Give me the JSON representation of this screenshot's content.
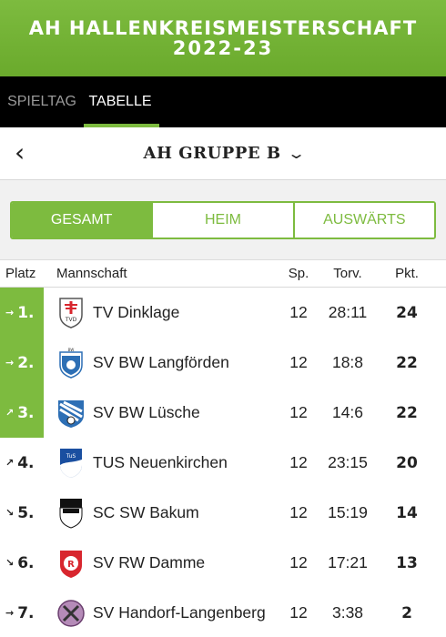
{
  "header": {
    "title": "AH HALLENKREISMEISTERSCHAFT",
    "season": "2022-23"
  },
  "tabs": [
    {
      "label": "SPIELTAG"
    },
    {
      "label": "TABELLE"
    }
  ],
  "group": {
    "back_icon": "chevron-left-icon",
    "title": "AH GRUPPE B",
    "dropdown_icon": "chevron-down-icon"
  },
  "segments": [
    {
      "label": "GESAMT"
    },
    {
      "label": "HEIM"
    },
    {
      "label": "AUSWÄRTS"
    }
  ],
  "columns": {
    "platz": "Platz",
    "team": "Mannschaft",
    "sp": "Sp.",
    "tor": "Torv.",
    "pkt": "Pkt."
  },
  "colors": {
    "accent": "#7dbb3f"
  },
  "rows": [
    {
      "rank": "1.",
      "trend": "→",
      "team": "TV Dinklage",
      "sp": "12",
      "tor": "28:11",
      "pkt": "24",
      "logo": "tv-dinklage-crest"
    },
    {
      "rank": "2.",
      "trend": "→",
      "team": "SV BW Langförden",
      "sp": "12",
      "tor": "18:8",
      "pkt": "22",
      "logo": "sv-bw-langfoerden-crest"
    },
    {
      "rank": "3.",
      "trend": "↗",
      "team": "SV BW Lüsche",
      "sp": "12",
      "tor": "14:6",
      "pkt": "22",
      "logo": "sv-bw-luesche-crest"
    },
    {
      "rank": "4.",
      "trend": "↗",
      "team": "TUS Neuenkirchen",
      "sp": "12",
      "tor": "23:15",
      "pkt": "20",
      "logo": "tus-neuenkirchen-crest"
    },
    {
      "rank": "5.",
      "trend": "↘",
      "team": "SC SW Bakum",
      "sp": "12",
      "tor": "15:19",
      "pkt": "14",
      "logo": "sc-sw-bakum-crest"
    },
    {
      "rank": "6.",
      "trend": "↘",
      "team": "SV RW Damme",
      "sp": "12",
      "tor": "17:21",
      "pkt": "13",
      "logo": "sv-rw-damme-crest"
    },
    {
      "rank": "7.",
      "trend": "→",
      "team": "SV Handorf-Langenberg",
      "sp": "12",
      "tor": "3:38",
      "pkt": "2",
      "logo": "sv-handorf-langenberg-crest"
    }
  ]
}
